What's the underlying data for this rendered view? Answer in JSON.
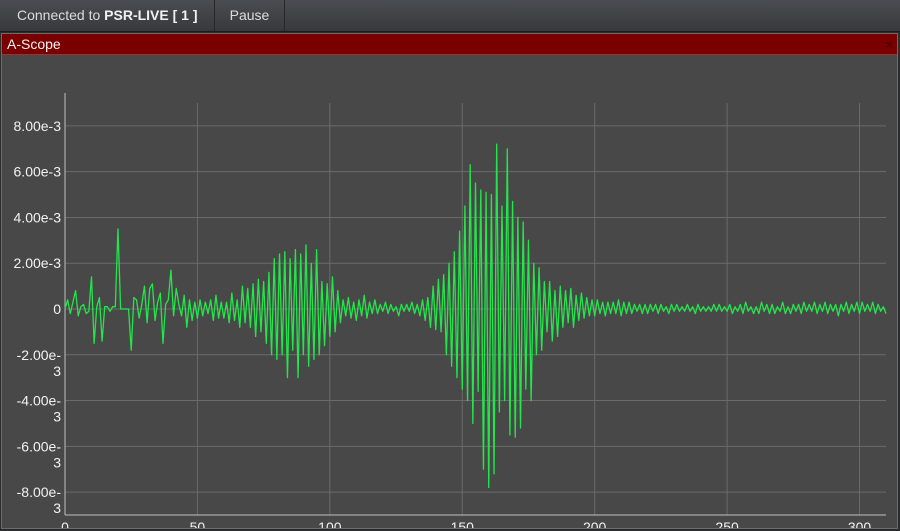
{
  "toolbar": {
    "status_prefix": "Connected to ",
    "status_target": "PSR-LIVE [ 1 ]",
    "pause_label": "Pause"
  },
  "panel": {
    "title": "A-Scope",
    "close_glyph": "×"
  },
  "colors": {
    "trace": "#22e64a",
    "title_bar": "#7a0000",
    "plot_bg": "#484848",
    "grid": "#6a6a6a"
  },
  "chart_data": {
    "type": "line",
    "title": "",
    "xlabel": "",
    "ylabel": "",
    "xlim": [
      0,
      310
    ],
    "ylim": [
      -0.009,
      0.009
    ],
    "grid": true,
    "legend": "none",
    "x_ticks": [
      {
        "value": 0,
        "label": "0"
      },
      {
        "value": 50,
        "label": "50"
      },
      {
        "value": 100,
        "label": "100"
      },
      {
        "value": 150,
        "label": "150"
      },
      {
        "value": 200,
        "label": "200"
      },
      {
        "value": 250,
        "label": "250"
      },
      {
        "value": 300,
        "label": "300"
      }
    ],
    "y_ticks": [
      {
        "value": 0.008,
        "label": [
          "8.00e-3"
        ]
      },
      {
        "value": 0.006,
        "label": [
          "6.00e-3"
        ]
      },
      {
        "value": 0.004,
        "label": [
          "4.00e-3"
        ]
      },
      {
        "value": 0.002,
        "label": [
          "2.00e-3"
        ]
      },
      {
        "value": 0,
        "label": [
          "0"
        ]
      },
      {
        "value": -0.002,
        "label": [
          "-2.00e-",
          "3"
        ]
      },
      {
        "value": -0.004,
        "label": [
          "-4.00e-",
          "3"
        ]
      },
      {
        "value": -0.006,
        "label": [
          "-6.00e-",
          "3"
        ]
      },
      {
        "value": -0.008,
        "label": [
          "-8.00e-",
          "3"
        ]
      }
    ],
    "series": [
      {
        "x_start": 0,
        "x_step": 1,
        "values": [
          0.0,
          0.0004,
          -0.0002,
          0.0003,
          0.0008,
          -0.0003,
          0.0001,
          0.0002,
          -0.0002,
          -0.0001,
          0.0014,
          -0.0015,
          0.0001,
          0.0005,
          -0.0014,
          0.0001,
          0.0001,
          -0.0001,
          0.0001,
          0.0001,
          0.0035,
          0.0,
          0.0,
          0.0,
          0.0,
          -0.0018,
          0.0005,
          0.0004,
          -0.0004,
          0.0002,
          0.001,
          -0.0006,
          0.0009,
          0.0011,
          -0.0005,
          0.0003,
          0.0007,
          -0.0015,
          0.0002,
          0.0004,
          0.0017,
          -0.0003,
          0.0009,
          0.0002,
          -0.0003,
          0.0006,
          -0.0008,
          0.0004,
          -0.0005,
          0.0003,
          -0.0004,
          0.0004,
          -0.0003,
          0.0003,
          -0.0002,
          0.0004,
          -0.0005,
          0.0006,
          -0.0004,
          0.0003,
          -0.0004,
          0.0003,
          -0.0006,
          0.0007,
          -0.0005,
          0.0004,
          -0.0008,
          0.001,
          -0.0006,
          0.0009,
          -0.0008,
          0.0011,
          -0.0012,
          0.0013,
          -0.001,
          0.0012,
          -0.0015,
          0.0016,
          -0.002,
          0.0022,
          -0.0022,
          0.0024,
          -0.002,
          0.0025,
          -0.003,
          0.0022,
          -0.0018,
          0.0026,
          -0.003,
          0.0024,
          -0.002,
          0.0028,
          -0.0025,
          0.002,
          -0.0022,
          0.0026,
          -0.002,
          0.0012,
          -0.0016,
          0.0011,
          -0.0012,
          0.0014,
          -0.001,
          0.0008,
          -0.0006,
          0.0004,
          -0.0003,
          0.0005,
          -0.0004,
          0.0003,
          -0.0005,
          0.0004,
          -0.0003,
          0.0006,
          -0.0004,
          0.0003,
          -0.0002,
          0.0004,
          -0.0002,
          0.0002,
          -0.0001,
          0.0003,
          -0.0002,
          0.0002,
          -0.0001,
          0.0001,
          -0.0003,
          0.0002,
          -0.0001,
          0.0002,
          -0.0001,
          0.0003,
          -0.0002,
          0.0002,
          -0.0003,
          0.0004,
          -0.0005,
          0.0005,
          -0.0008,
          0.001,
          -0.0009,
          0.0013,
          -0.001,
          0.0015,
          -0.002,
          0.002,
          -0.0025,
          0.0025,
          -0.003,
          0.0034,
          -0.0035,
          0.0045,
          -0.004,
          0.0063,
          -0.005,
          0.0055,
          -0.0036,
          0.0052,
          -0.007,
          0.0051,
          -0.0078,
          0.005,
          -0.0072,
          0.0072,
          -0.0045,
          0.0045,
          -0.004,
          0.007,
          -0.0055,
          0.0047,
          -0.0056,
          0.004,
          -0.0052,
          0.0038,
          -0.0035,
          0.003,
          -0.004,
          0.002,
          -0.002,
          0.0018,
          -0.0018,
          0.0012,
          -0.001,
          0.0012,
          -0.0014,
          0.0008,
          -0.0012,
          0.001,
          -0.0008,
          0.0008,
          -0.0006,
          0.0009,
          -0.0008,
          0.0006,
          -0.0005,
          0.0007,
          -0.0004,
          0.0005,
          -0.0003,
          0.0004,
          -0.0003,
          0.0004,
          -0.0002,
          0.0003,
          -0.0003,
          0.0003,
          -0.0002,
          0.0003,
          -0.0002,
          0.0004,
          -0.0003,
          0.0003,
          -0.0002,
          0.0003,
          -0.0002,
          0.0002,
          -0.0001,
          0.0002,
          -0.0002,
          0.0002,
          -0.0002,
          0.0002,
          -0.0001,
          0.0002,
          -0.0002,
          0.0002,
          -0.0001,
          0.0001,
          -0.0002,
          0.0002,
          -0.0001,
          0.0002,
          -0.0001,
          0.0001,
          -0.0001,
          0.0002,
          -0.0001,
          0.0001,
          -0.0002,
          0.0002,
          -0.0001,
          0.0001,
          -0.0001,
          0.0001,
          -0.0001,
          0.0002,
          -0.0001,
          0.0002,
          -0.0001,
          0.0001,
          -0.0001,
          0.0002,
          -0.0002,
          0.0001,
          -0.0001,
          0.0002,
          -0.0002,
          0.0003,
          -0.0001,
          0.0001,
          -0.0002,
          0.0001,
          -0.0002,
          0.0003,
          -0.0001,
          0.0002,
          -0.0002,
          0.0002,
          -0.0002,
          0.0001,
          -0.0001,
          0.0003,
          -0.0002,
          0.0001,
          -0.0002,
          0.0002,
          -0.0001,
          0.0002,
          -0.0002,
          0.0003,
          -0.0001,
          0.0002,
          -0.0001,
          0.0003,
          -0.0002,
          0.0002,
          -0.0001,
          0.0003,
          -0.0002,
          0.0002,
          -0.0001,
          0.0002,
          -0.0003,
          0.0002,
          -0.0001,
          0.0003,
          -0.0002,
          0.0002,
          -0.0001,
          0.0003,
          -0.0002,
          0.0003,
          -0.0001,
          0.0002,
          -0.0001,
          0.0003,
          -0.0002,
          0.0002,
          -0.0001,
          0.0001,
          -0.0002
        ]
      }
    ]
  }
}
